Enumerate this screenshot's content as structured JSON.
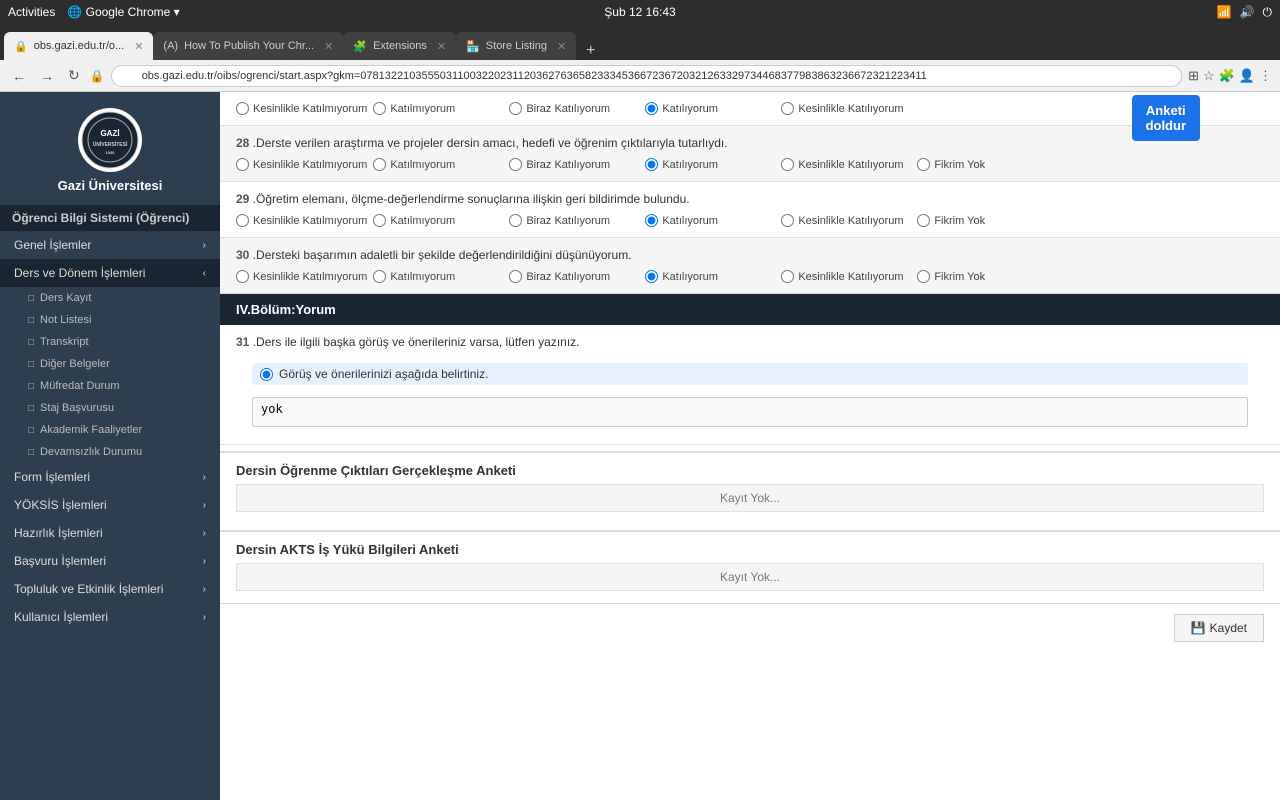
{
  "os": {
    "activities": "Activities",
    "browser_name": "Google Chrome",
    "date_time": "Şub 12  16:43"
  },
  "tabs": [
    {
      "id": "tab1",
      "label": "obs.gazi.edu.tr/o...",
      "active": true,
      "icon": "🔒"
    },
    {
      "id": "tab2",
      "label": "How To Publish Your Chr...",
      "active": false,
      "icon": "(A)"
    },
    {
      "id": "tab3",
      "label": "Extensions",
      "active": false,
      "icon": "🧩"
    },
    {
      "id": "tab4",
      "label": "Store Listing",
      "active": false,
      "icon": "🏪"
    }
  ],
  "address_bar": {
    "url": "obs.gazi.edu.tr/oibs/ogrenci/start.aspx?gkm=078132210355503110032202311203627636582333453667236720321263329734468377983863236672321223411"
  },
  "anketi_btn": "Anketi\ndoldur",
  "sidebar": {
    "logo_text": "GAZİ",
    "university_name": "Gazi Üniversitesi",
    "system_name": "Öğrenci Bilgi Sistemi (Öğrenci)",
    "menu_items": [
      {
        "id": "genel",
        "label": "Genel İşlemler",
        "has_arrow": true,
        "expanded": false
      },
      {
        "id": "ders",
        "label": "Ders ve Dönem İşlemleri",
        "has_arrow": true,
        "expanded": true
      },
      {
        "id": "form",
        "label": "Form İşlemleri",
        "has_arrow": true,
        "expanded": false
      },
      {
        "id": "yoksis",
        "label": "YÖKSİS İşlemleri",
        "has_arrow": true,
        "expanded": false
      },
      {
        "id": "hazirlik",
        "label": "Hazırlık İşlemleri",
        "has_arrow": true,
        "expanded": false
      },
      {
        "id": "basvuru",
        "label": "Başvuru İşlemleri",
        "has_arrow": true,
        "expanded": false
      },
      {
        "id": "topluluk",
        "label": "Topluluk ve Etkinlik İşlemleri",
        "has_arrow": true,
        "expanded": false
      },
      {
        "id": "kullanici",
        "label": "Kullanıcı İşlemleri",
        "has_arrow": true,
        "expanded": false
      }
    ],
    "submenu_items": [
      {
        "id": "ders-kayit",
        "label": "Ders Kayıt"
      },
      {
        "id": "not-listesi",
        "label": "Not Listesi"
      },
      {
        "id": "transkript",
        "label": "Transkript"
      },
      {
        "id": "diger-belgeler",
        "label": "Diğer Belgeler"
      },
      {
        "id": "mufredat-durum",
        "label": "Müfredat Durum"
      },
      {
        "id": "staj-basvurusu",
        "label": "Staj Başvurusu"
      },
      {
        "id": "akademik",
        "label": "Akademik Faaliyetler"
      },
      {
        "id": "devamsizlik",
        "label": "Devamsızlık Durumu"
      }
    ]
  },
  "questions": [
    {
      "id": "q27_options",
      "options": [
        "Kesinlikle Katılmıyorum",
        "Katılmıyorum",
        "Biraz Katılıyorum",
        "Katılıyorum",
        "Kesinlikle Katılıyorum"
      ],
      "selected": "Katılıyorum",
      "shaded": false,
      "show_fikrim_yok": false
    },
    {
      "id": "q28",
      "number": "28",
      "text": "Derste verilen araştırma ve projeler dersin amacı, hedefi ve öğrenim çıktılarıyla tutarlıydı.",
      "options": [
        "Kesinlikle Katılmıyorum",
        "Katılmıyorum",
        "Biraz Katılıyorum",
        "Katılıyorum",
        "Kesinlikle Katılıyorum",
        "Fikrim Yok"
      ],
      "selected": "Katılıyorum",
      "shaded": true,
      "show_fikrim_yok": true
    },
    {
      "id": "q29",
      "number": "29",
      "text": "Öğretim elemanı, ölçme-değerlendirme sonuçlarına ilişkin geri bildirimde bulundu.",
      "options": [
        "Kesinlikle Katılmıyorum",
        "Katılmıyorum",
        "Biraz Katılıyorum",
        "Katılıyorum",
        "Kesinlikle Katılıyorum",
        "Fikrim Yok"
      ],
      "selected": "Katılıyorum",
      "shaded": false,
      "show_fikrim_yok": true
    },
    {
      "id": "q30",
      "number": "30",
      "text": "Dersteki başarımın adaletli bir şekilde değerlendirildiğini düşünüyorum.",
      "options": [
        "Kesinlikle Katılmıyorum",
        "Katılmıyorum",
        "Biraz Katılıyorum",
        "Katılıyorum",
        "Kesinlikle Katılıyorum",
        "Fikrim Yok"
      ],
      "selected": "Katılıyorum",
      "shaded": true,
      "show_fikrim_yok": true
    }
  ],
  "section4": {
    "label": "IV.Bölüm:",
    "title": "Yorum"
  },
  "q31": {
    "number": "31",
    "text": "Ders ile ilgili başka görüş ve önerileriniz varsa, lütfen yazınız.",
    "radio_label": "Görüş ve önerilerinizi aşağıda belirtiniz.",
    "textarea_value": "yok"
  },
  "sub_surveys": [
    {
      "id": "ogrenme-ciktilari",
      "title": "Dersin Öğrenme Çıktıları Gerçekleşme Anketi",
      "kayit_yok": "Kayıt Yok..."
    },
    {
      "id": "akts-yuku",
      "title": "Dersin AKTS İş Yükü Bilgileri Anketi",
      "kayit_yok": "Kayıt Yok..."
    }
  ],
  "footer": {
    "kaydet_label": "Kaydet",
    "kaydet_icon": "💾"
  }
}
